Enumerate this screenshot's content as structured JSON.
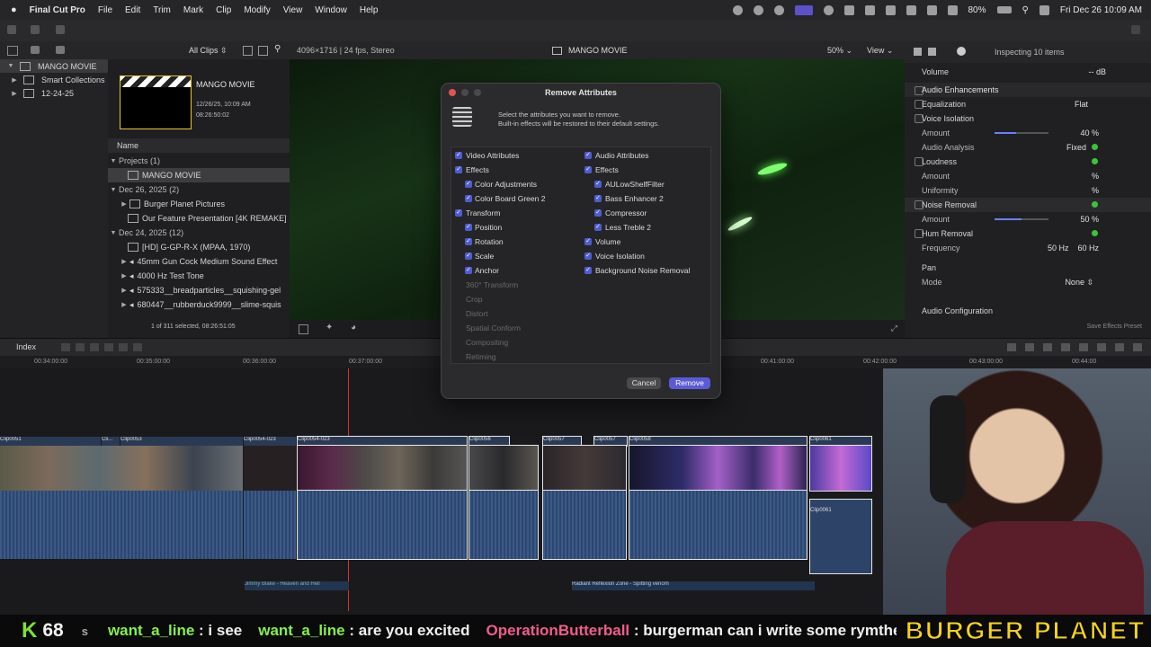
{
  "menubar": {
    "app_name": "Final Cut Pro",
    "items": [
      "File",
      "Edit",
      "Trim",
      "Mark",
      "Clip",
      "Modify",
      "View",
      "Window",
      "Help"
    ],
    "battery": "80%",
    "datetime": "Fri Dec 26  10:09 AM"
  },
  "browser": {
    "filter_label": "All Clips",
    "library_name": "MANGO MOVIE",
    "library_items": [
      "Smart Collections",
      "12-24-25"
    ],
    "preview_title": "MANGO MOVIE",
    "preview_date": "12/26/25, 10:09 AM",
    "preview_duration": "08:26:50:02",
    "column_name": "Name",
    "rows": [
      {
        "label": "Projects",
        "count": "(1)",
        "type": "group"
      },
      {
        "label": "MANGO MOVIE",
        "type": "item",
        "selected": true
      },
      {
        "label": "Dec 26, 2025",
        "count": "(2)",
        "type": "group"
      },
      {
        "label": "Burger Planet Pictures",
        "type": "item"
      },
      {
        "label": "Our Feature Presentation [4K REMAKE]",
        "type": "item"
      },
      {
        "label": "Dec 24, 2025",
        "count": "(12)",
        "type": "group"
      },
      {
        "label": "[HD] G-GP-R-X (MPAA, 1970)",
        "type": "item"
      },
      {
        "label": "45mm Gun Cock Medium Sound Effect",
        "type": "item"
      },
      {
        "label": "4000 Hz Test Tone",
        "type": "item"
      },
      {
        "label": "575333__breadparticles__squishing-gel",
        "type": "item"
      },
      {
        "label": "680447__rubberduck9999__slime-squis",
        "type": "item"
      }
    ],
    "footer": "1 of 311 selected, 08:26:51:05"
  },
  "viewer": {
    "format": "4096×1716 | 24 fps, Stereo",
    "title": "MANGO MOVIE",
    "zoom": "50%",
    "view_label": "View"
  },
  "inspector": {
    "header": "Inspecting 10 items",
    "volume_label": "Volume",
    "volume_value": "-- dB",
    "enhancements": "Audio Enhancements",
    "rows": [
      {
        "label": "Equalization",
        "value": "Flat"
      },
      {
        "label": "Voice Isolation",
        "value": ""
      },
      {
        "label": "Amount",
        "value": "40 %"
      },
      {
        "label": "Audio Analysis",
        "value": "Fixed"
      },
      {
        "label": "Loudness",
        "value": ""
      },
      {
        "label": "Amount",
        "value": "% "
      },
      {
        "label": "Uniformity",
        "value": "%"
      },
      {
        "label": "Noise Removal",
        "value": ""
      },
      {
        "label": "Amount",
        "value": "50 %"
      },
      {
        "label": "Hum Removal",
        "value": ""
      },
      {
        "label": "Frequency",
        "value": "50 Hz    60 Hz"
      }
    ],
    "pan": "Pan",
    "mode_label": "Mode",
    "mode_value": "None",
    "audio_config": "Audio Configuration",
    "save_preset": "Save Effects Preset"
  },
  "timeline": {
    "index_label": "Index",
    "ruler": [
      "00:34:00:00",
      "00:35:00:00",
      "00:36:00:00",
      "00:37:00:00",
      "00:41:00:00",
      "00:42:00:00",
      "00:43:00:00",
      "00:44:00"
    ],
    "clips": [
      "Clip0051",
      "Cli...",
      "Clip0053",
      "Clip0054-023",
      "Clip0054-023",
      "Clip0056",
      "Clip0057",
      "Clip0057",
      "Clip0058",
      "Clip0061",
      "Clip0061"
    ],
    "audio_labels": [
      "Jimmy Blake - Heaven and Hell",
      "Radiant Reflexion Zone - Spitting venom"
    ]
  },
  "dialog": {
    "title": "Remove Attributes",
    "instruction_1": "Select the attributes you want to remove.",
    "instruction_2": "Built-in effects will be restored to their default settings.",
    "video_header": "Video Attributes",
    "audio_header": "Audio Attributes",
    "video_items": [
      {
        "label": "Effects",
        "level": 0,
        "checked": true
      },
      {
        "label": "Color Adjustments",
        "level": 1,
        "checked": true
      },
      {
        "label": "Color Board Green 2",
        "level": 1,
        "checked": true
      },
      {
        "label": "Transform",
        "level": 0,
        "checked": true
      },
      {
        "label": "Position",
        "level": 1,
        "checked": true
      },
      {
        "label": "Rotation",
        "level": 1,
        "checked": true
      },
      {
        "label": "Scale",
        "level": 1,
        "checked": true
      },
      {
        "label": "Anchor",
        "level": 1,
        "checked": true
      },
      {
        "label": "360° Transform",
        "level": 0,
        "checked": false
      },
      {
        "label": "Crop",
        "level": 0,
        "checked": false
      },
      {
        "label": "Distort",
        "level": 0,
        "checked": false
      },
      {
        "label": "Spatial Conform",
        "level": 0,
        "checked": false
      },
      {
        "label": "Compositing",
        "level": 0,
        "checked": false
      },
      {
        "label": "Retiming",
        "level": 0,
        "checked": false
      }
    ],
    "audio_items": [
      {
        "label": "Effects",
        "level": 0,
        "checked": true
      },
      {
        "label": "AULowShelfFilter",
        "level": 1,
        "checked": true
      },
      {
        "label": "Bass Enhancer 2",
        "level": 1,
        "checked": true
      },
      {
        "label": "Compressor",
        "level": 1,
        "checked": true
      },
      {
        "label": "Less Treble 2",
        "level": 1,
        "checked": true
      },
      {
        "label": "Volume",
        "level": 0,
        "checked": true
      },
      {
        "label": "Voice Isolation",
        "level": 0,
        "checked": true
      },
      {
        "label": "Background Noise Removal",
        "level": 0,
        "checked": true
      }
    ],
    "cancel": "Cancel",
    "remove": "Remove"
  },
  "stream": {
    "k_label": "K",
    "k_count": "68",
    "chat": [
      {
        "user": "s",
        "msg": ""
      },
      {
        "user": "want_a_line",
        "msg": ": i see"
      },
      {
        "user": "want_a_line",
        "msg": ": are you excited"
      },
      {
        "user": "OperationButterball",
        "msg": ": burgerman can i write some rymthes for u"
      }
    ],
    "brand": "BURGER PLANET"
  }
}
